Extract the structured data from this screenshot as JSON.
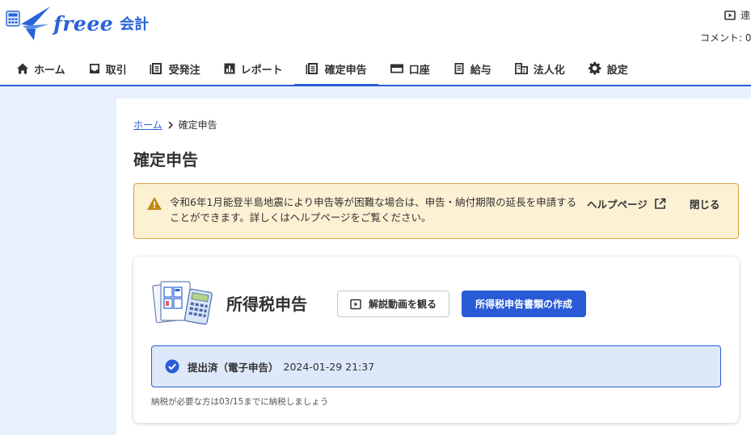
{
  "header": {
    "logo_word": "freee",
    "logo_sub": "会計",
    "topright_label": "連",
    "comment_label": "コメント: 0"
  },
  "nav": [
    {
      "label": "ホーム",
      "icon": "home-icon"
    },
    {
      "label": "取引",
      "icon": "inbox-icon"
    },
    {
      "label": "受発注",
      "icon": "document-icon"
    },
    {
      "label": "レポート",
      "icon": "chart-icon"
    },
    {
      "label": "確定申告",
      "icon": "tax-document-icon",
      "active": true
    },
    {
      "label": "口座",
      "icon": "credit-card-icon"
    },
    {
      "label": "給与",
      "icon": "receipt-icon"
    },
    {
      "label": "法人化",
      "icon": "building-icon"
    },
    {
      "label": "設定",
      "icon": "gear-icon"
    }
  ],
  "breadcrumb": {
    "home": "ホーム",
    "current": "確定申告"
  },
  "page_title": "確定申告",
  "notice": {
    "text": "令和6年1月能登半島地震により申告等が困難な場合は、申告・納付期限の延長を申請することができます。詳しくはヘルプページをご覧ください。",
    "help_label": "ヘルプページ",
    "close_label": "閉じる"
  },
  "card": {
    "title": "所得税申告",
    "video_button": "解説動画を観る",
    "create_button": "所得税申告書類の作成",
    "status_label": "提出済（電子申告）",
    "status_date": "2024-01-29 21:37",
    "note": "納税が必要な方は03/15までに納税しましょう"
  },
  "colors": {
    "accent": "#2a5bd7",
    "notice_bg": "#fdf1d3",
    "notice_border": "#d6a63a",
    "page_bg": "#e8f0fc"
  }
}
